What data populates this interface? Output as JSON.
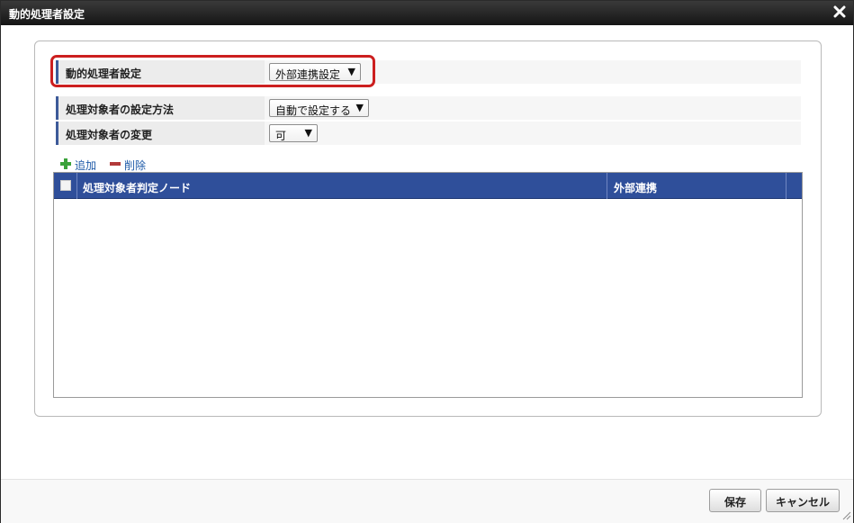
{
  "dialog": {
    "title": "動的処理者設定"
  },
  "form": {
    "rows": [
      {
        "label": "動的処理者設定",
        "value": "外部連携設定"
      },
      {
        "label": "処理対象者の設定方法",
        "value": "自動で設定する"
      },
      {
        "label": "処理対象者の変更",
        "value": "可"
      }
    ]
  },
  "toolbar": {
    "add_label": "追加",
    "delete_label": "削除"
  },
  "grid": {
    "columns": [
      "処理対象者判定ノード",
      "外部連携"
    ],
    "rows": []
  },
  "footer": {
    "save_label": "保存",
    "cancel_label": "キャンセル"
  },
  "colors": {
    "titlebar": "#1c1c1c",
    "grid_header": "#2f4f9a",
    "highlight": "#cc1f1f",
    "link": "#1e5aa8"
  }
}
